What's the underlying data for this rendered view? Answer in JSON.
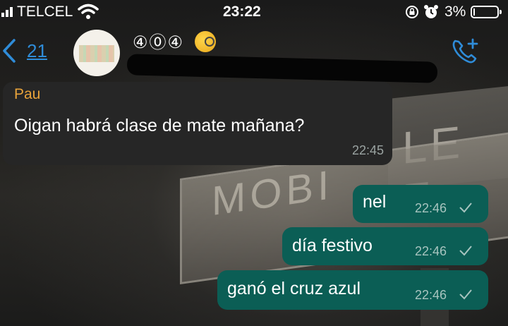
{
  "status_bar": {
    "carrier": "TELCEL",
    "time": "23:22",
    "battery_percent": "3%",
    "battery_level": 0.03
  },
  "header": {
    "back_count": "21",
    "chat_title": "④⓪④",
    "title_emoji": "face-with-monocle"
  },
  "messages": [
    {
      "direction": "in",
      "sender": "Pau",
      "text": "Oigan habrá clase de mate mañana?",
      "time": "22:45"
    },
    {
      "direction": "out",
      "text": "nel",
      "time": "22:46",
      "status": "sent"
    },
    {
      "direction": "out",
      "text": "día festivo",
      "time": "22:46",
      "status": "sent"
    },
    {
      "direction": "out",
      "text": "ganó el cruz azul",
      "time": "22:46",
      "status": "sent"
    }
  ],
  "colors": {
    "accent": "#2f8cd8",
    "outgoing_bubble": "#0b5e55",
    "incoming_bubble": "#262626",
    "sender_name": "#e8a33a"
  }
}
